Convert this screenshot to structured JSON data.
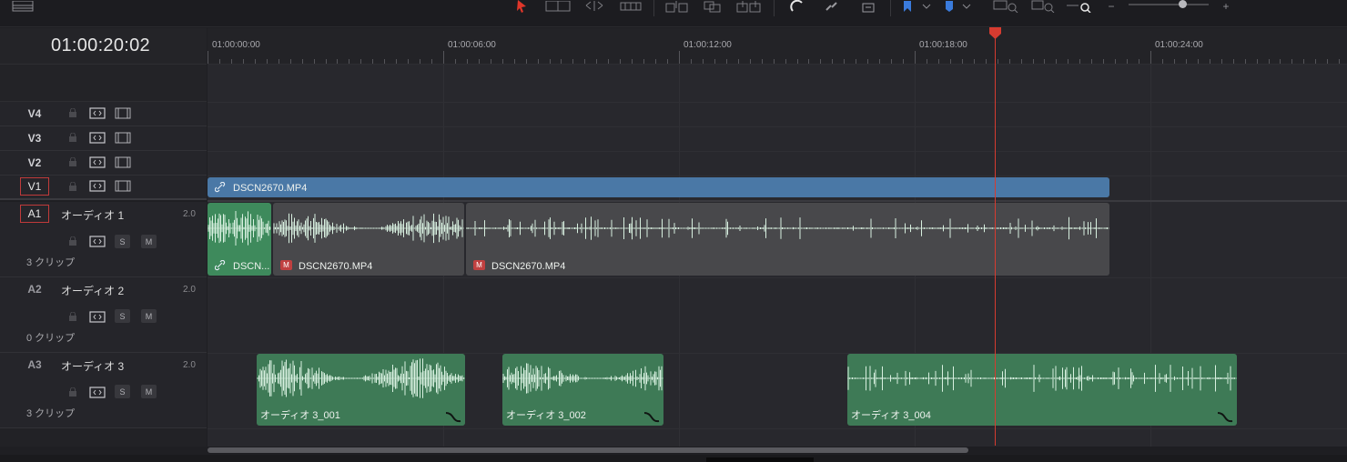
{
  "toolbar": {
    "icons": [
      "panel-layout-icon",
      "selection-pointer-icon",
      "trim-edit-icon",
      "dynamic-trim-icon",
      "blade-icon",
      "insert-clip-icon",
      "overwrite-clip-icon",
      "replace-clip-icon",
      "snapping-icon",
      "linked-selection-icon",
      "position-lock-icon",
      "flag-icon",
      "marker-icon",
      "zoom-full-icon",
      "zoom-detail-icon",
      "zoom-custom-icon",
      "zoom-out-icon",
      "zoom-slider",
      "zoom-in-icon"
    ],
    "zoom_out_label": "−",
    "zoom_in_label": "+",
    "zoom_level": 0.68
  },
  "timecode": "01:00:20:02",
  "ruler": {
    "labels": [
      "01:00:00:00",
      "01:00:06:00",
      "01:00:12:00",
      "01:00:18:00",
      "01:00:24:00"
    ]
  },
  "tracks": {
    "v4": {
      "label": "V4"
    },
    "v3": {
      "label": "V3"
    },
    "v2": {
      "label": "V2"
    },
    "v1": {
      "label": "V1"
    },
    "a1": {
      "label": "A1",
      "name": "オーディオ 1",
      "level": "2.0",
      "clips": "3 クリップ",
      "s": "S",
      "m": "M"
    },
    "a2": {
      "label": "A2",
      "name": "オーディオ 2",
      "level": "2.0",
      "clips": "0 クリップ",
      "s": "S",
      "m": "M"
    },
    "a3": {
      "label": "A3",
      "name": "オーディオ 3",
      "level": "2.0",
      "clips": "3 クリップ",
      "s": "S",
      "m": "M"
    }
  },
  "clips": {
    "v1_clip": "DSCN2670.MP4",
    "a1_clip1": "DSCN...",
    "a1_clip2": "DSCN2670.MP4",
    "a1_clip3": "DSCN2670.MP4",
    "a1_badge": "M",
    "a3_clip1": "オーディオ 3_001",
    "a3_clip2": "オーディオ 3_002",
    "a3_clip3": "オーディオ 3_004"
  },
  "colors": {
    "video_clip": "#4a78a6",
    "audio_linked_clip": "#3e8a5c",
    "audio_clip": "#48484b",
    "audio_clip_a3": "#3e7a56",
    "waveform": "#d8f0e0",
    "playhead": "#d63b30",
    "armed_border": "#c03a3a"
  }
}
